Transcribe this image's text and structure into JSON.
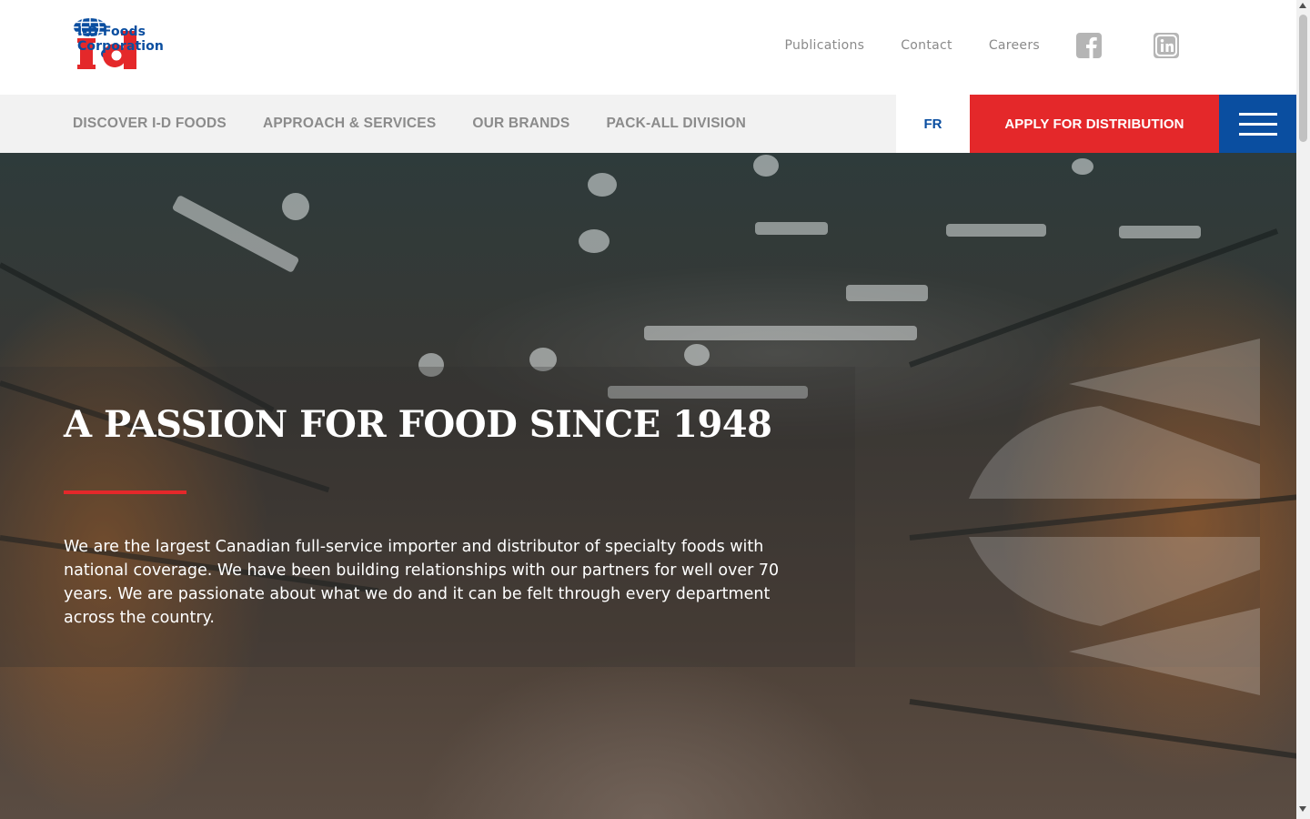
{
  "brand": {
    "logo_line1": "I-D Foods",
    "logo_line2": "Corporation",
    "colors": {
      "red": "#e4282a",
      "blue": "#0a4ea0"
    }
  },
  "utility_nav": {
    "items": [
      "Publications",
      "Contact",
      "Careers"
    ],
    "social": [
      "facebook-icon",
      "linkedin-icon"
    ]
  },
  "main_nav": {
    "items": [
      "DISCOVER I-D FOODS",
      "APPROACH & SERVICES",
      "OUR BRANDS",
      "PACK-ALL DIVISION"
    ],
    "language": "FR",
    "cta": "APPLY FOR DISTRIBUTION",
    "menu_icon": "hamburger-icon"
  },
  "hero": {
    "title": "A PASSION FOR FOOD SINCE 1948",
    "body": "We are the largest Canadian full-service importer and distributor of specialty foods with national coverage. We have been building relationships with our partners for well over 70 years. We are passionate about what we do and it can be felt through every department across the country."
  }
}
